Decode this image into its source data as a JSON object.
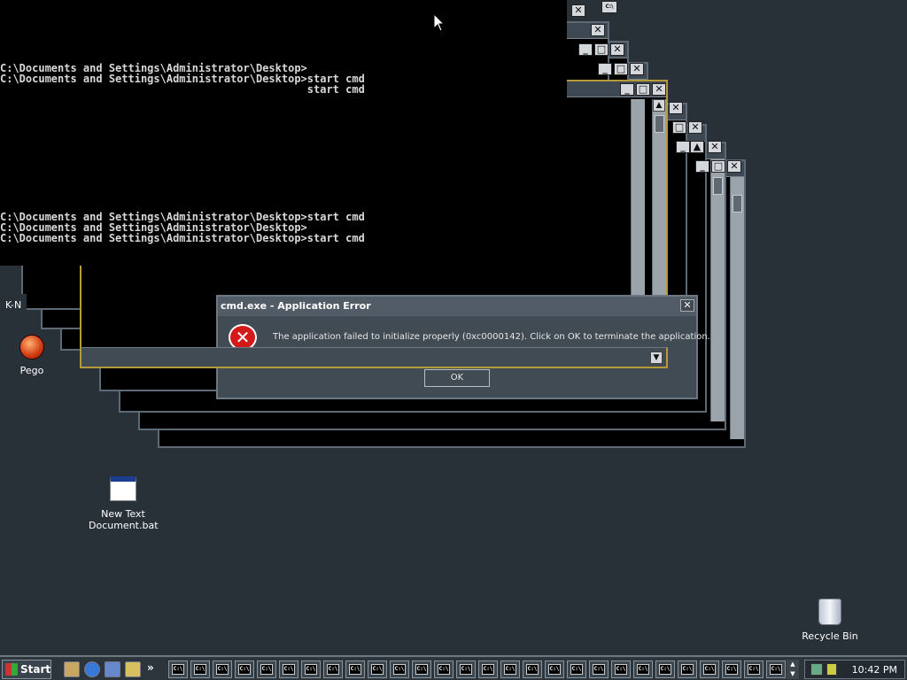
{
  "console": {
    "lines_top": [
      "C:\\Documents and Settings\\Administrator\\Desktop>",
      "C:\\Documents and Settings\\Administrator\\Desktop>start cmd",
      "                                                start cmd"
    ],
    "lines_mid": [
      "C:\\Documents and Settings\\Administrator\\Desktop>start cmd",
      "C:\\Documents and Settings\\Administrator\\Desktop>",
      "C:\\Documents and Settings\\Administrator\\Desktop>start cmd"
    ],
    "mini_icon": "C:\\"
  },
  "dialog": {
    "title": "cmd.exe - Application Error",
    "message": "The application failed to initialize properly (0xc0000142). Click on OK to terminate the application.",
    "ok_label": "OK",
    "close_label": "✕"
  },
  "window_controls": {
    "minimize": "_",
    "maximize": "□",
    "close": "✕",
    "up": "▲",
    "down": "▼"
  },
  "desktop": {
    "partial_label": "K-N",
    "pego": "Pego",
    "bat": "New Text Document.bat",
    "recycle": "Recycle Bin"
  },
  "taskbar": {
    "start_label": "Start",
    "chevron": "»",
    "task_icon_label": "C:\\",
    "clock": "10:42 PM",
    "task_count": 28
  },
  "colors": {
    "desktop": "#283038",
    "console": "#000000",
    "error_red": "#d21a1a"
  }
}
